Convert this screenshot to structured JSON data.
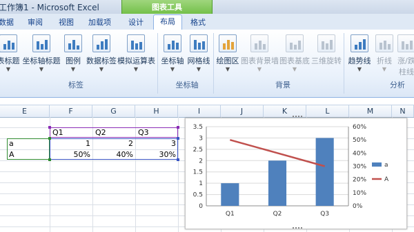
{
  "app": {
    "title": "工作簿1 - Microsoft Excel",
    "context_group": "图表工具"
  },
  "tabs": [
    {
      "label": "数据"
    },
    {
      "label": "审阅"
    },
    {
      "label": "视图"
    },
    {
      "label": "加载项"
    },
    {
      "label": "设计"
    },
    {
      "label": "布局"
    },
    {
      "label": "格式"
    }
  ],
  "ribbon": {
    "buttons": [
      {
        "label": "表标题",
        "icon": "chart-title-icon"
      },
      {
        "label": "坐标轴标题",
        "icon": "axis-title-icon"
      },
      {
        "label": "图例",
        "icon": "legend-icon"
      },
      {
        "label": "数据标签",
        "icon": "data-labels-icon"
      },
      {
        "label": "模拟运算表",
        "icon": "data-table-icon"
      },
      {
        "label": "坐标轴",
        "icon": "axes-icon"
      },
      {
        "label": "网格线",
        "icon": "gridlines-icon"
      },
      {
        "label": "绘图区",
        "icon": "plot-area-icon"
      },
      {
        "label": "图表背景墙",
        "icon": "chart-wall-icon"
      },
      {
        "label": "图表基底",
        "icon": "chart-floor-icon"
      },
      {
        "label": "三维旋转",
        "icon": "3d-rotation-icon"
      },
      {
        "label": "趋势线",
        "icon": "trendline-icon"
      },
      {
        "label": "折线",
        "icon": "lines-icon"
      },
      {
        "label": "涨/跌",
        "icon": "up-down-bars-icon"
      },
      {
        "label": "柱线",
        "icon": "bars-icon"
      }
    ],
    "groups": {
      "labels": "标签",
      "axes": "坐标轴",
      "background": "背景",
      "analysis": "分析"
    }
  },
  "sheet": {
    "columns": [
      "E",
      "F",
      "G",
      "H",
      "I",
      "J",
      "K",
      "L",
      "M",
      "N"
    ],
    "cells": {
      "f_header": "Q1",
      "g_header": "Q2",
      "h_header": "Q3",
      "e_row1": "a",
      "f_row1": "1",
      "g_row1": "2",
      "h_row1": "3",
      "e_row2": "A",
      "f_row2": "50%",
      "g_row2": "40%",
      "h_row2": "30%"
    }
  },
  "chart_data": {
    "type": "bar",
    "categories": [
      "Q1",
      "Q2",
      "Q3"
    ],
    "series": [
      {
        "name": "a",
        "type": "bar",
        "axis": "left",
        "values": [
          1,
          2,
          3
        ],
        "color": "#4f81bd"
      },
      {
        "name": "A",
        "type": "line",
        "axis": "right",
        "values": [
          0.5,
          0.4,
          0.3
        ],
        "color": "#c0504d"
      }
    ],
    "y_left": {
      "min": 0,
      "max": 3.5,
      "ticks": [
        "0",
        "0.5",
        "1",
        "1.5",
        "2",
        "2.5",
        "3",
        "3.5"
      ]
    },
    "y_right": {
      "min": 0,
      "max": 0.6,
      "ticks": [
        "0%",
        "10%",
        "20%",
        "30%",
        "40%",
        "50%",
        "60%"
      ]
    },
    "grid": true,
    "legend": "right"
  }
}
